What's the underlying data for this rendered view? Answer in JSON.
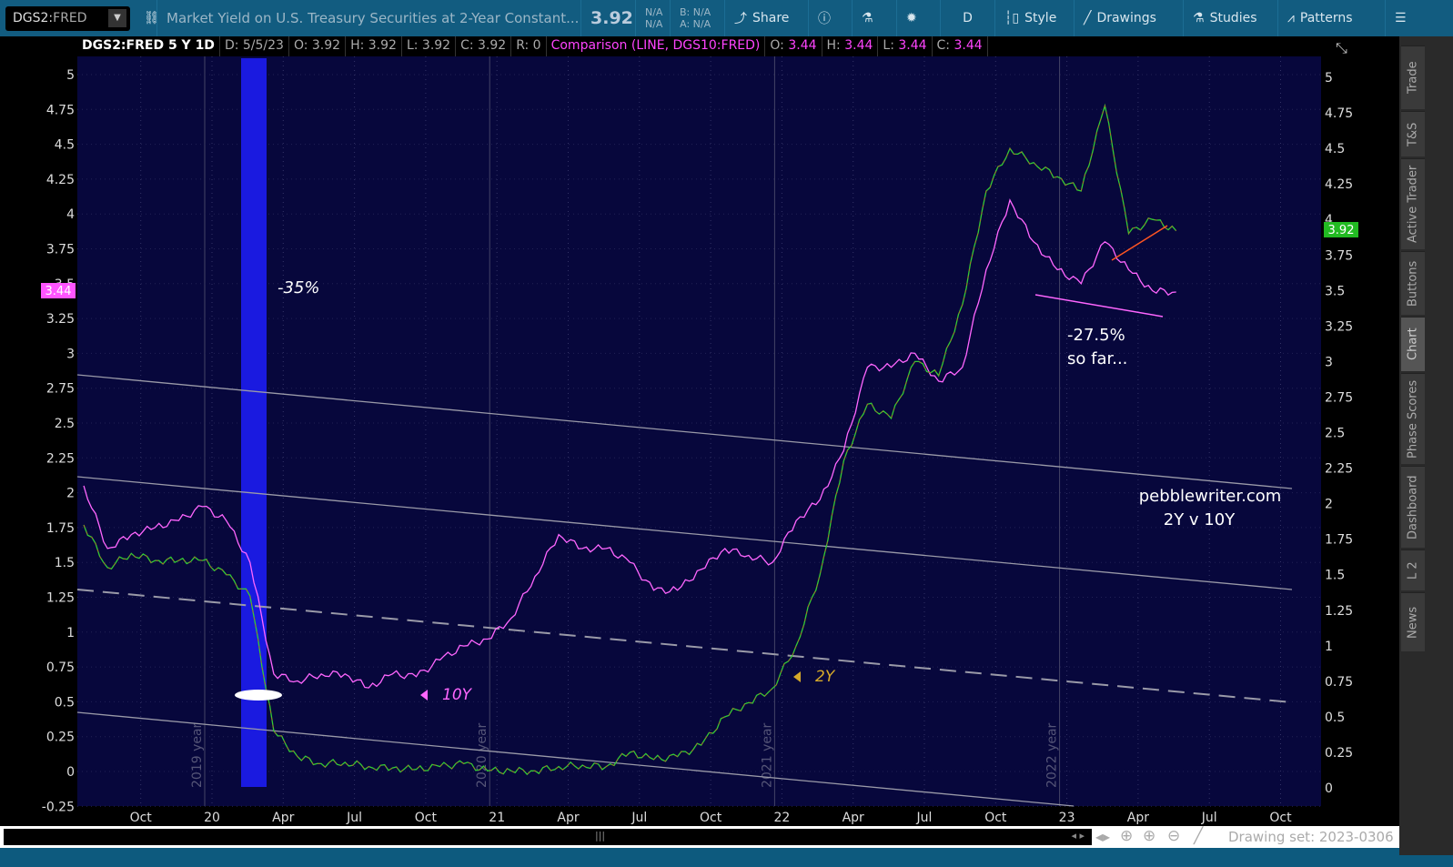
{
  "toolbar": {
    "symbol_prefix": "DGS2:",
    "symbol_suffix": "FRED",
    "description": "Market Yield on U.S. Treasury Securities at 2-Year Constant...",
    "last": "3.92",
    "na1": "N/A",
    "na2": "N/A",
    "bid": "B: N/A",
    "ask": "A: N/A",
    "share": "Share",
    "period": "D",
    "style": "Style",
    "drawings": "Drawings",
    "studies": "Studies",
    "patterns": "Patterns"
  },
  "info": {
    "title": "DGS2:FRED 5 Y 1D",
    "date": "D: 5/5/23",
    "o": "O: 3.92",
    "h": "H: 3.92",
    "l": "L: 3.92",
    "c": "C: 3.92",
    "r": "R: 0",
    "comparison": "Comparison (LINE, DGS10:FRED)",
    "co_l": "O: ",
    "co": "3.44",
    "ch_l": "H: ",
    "ch": "3.44",
    "cl_l": "L: ",
    "cl": "3.44",
    "cc_l": "C: ",
    "cc": "3.44"
  },
  "sidebar": [
    "Trade",
    "T&S",
    "Active Trader",
    "Buttons",
    "Chart",
    "Phase Scores",
    "Dashboard",
    "L 2",
    "News"
  ],
  "bottom": {
    "drawing_set": "Drawing set: 2023-0306"
  },
  "annotations": {
    "drop1": "-35%",
    "drop2a": "-27.5%",
    "drop2b": "so far...",
    "site": "pebblewriter.com",
    "sub": "2Y v 10Y",
    "label10": "10Y",
    "label2": "2Y"
  },
  "chart_data": {
    "type": "line",
    "title": "DGS2:FRED 5 Y 1D vs DGS10:FRED",
    "start": "2019-07",
    "interval": "monthly",
    "series": [
      {
        "name": "DGS10 (10Y)",
        "color": "#ff66ff",
        "axis": "left",
        "values": [
          2.05,
          1.6,
          1.7,
          1.75,
          1.8,
          1.9,
          1.8,
          1.5,
          0.7,
          0.65,
          0.7,
          0.7,
          0.6,
          0.7,
          0.68,
          0.8,
          0.9,
          0.95,
          1.1,
          1.4,
          1.7,
          1.6,
          1.6,
          1.5,
          1.3,
          1.3,
          1.45,
          1.6,
          1.55,
          1.5,
          1.8,
          1.95,
          2.3,
          2.9,
          2.9,
          3.0,
          2.8,
          2.9,
          3.6,
          4.1,
          3.8,
          3.6,
          3.5,
          3.8,
          3.6,
          3.45,
          3.44
        ]
      },
      {
        "name": "DGS2 (2Y)",
        "color": "#33cc33",
        "axis": "right",
        "values": [
          1.85,
          1.55,
          1.65,
          1.6,
          1.6,
          1.6,
          1.5,
          1.35,
          0.4,
          0.22,
          0.17,
          0.18,
          0.15,
          0.14,
          0.13,
          0.15,
          0.17,
          0.12,
          0.12,
          0.12,
          0.15,
          0.16,
          0.15,
          0.25,
          0.2,
          0.22,
          0.3,
          0.5,
          0.6,
          0.7,
          1.0,
          1.5,
          2.3,
          2.7,
          2.6,
          3.0,
          2.9,
          3.4,
          4.2,
          4.5,
          4.4,
          4.3,
          4.2,
          4.8,
          3.9,
          4.0,
          3.92
        ]
      }
    ],
    "left_ticks": [
      "5",
      "4.75",
      "4.5",
      "4.25",
      "4",
      "3.75",
      "3.5",
      "3.25",
      "3",
      "2.75",
      "2.5",
      "2.25",
      "2",
      "1.75",
      "1.5",
      "1.25",
      "1",
      "0.75",
      "0.5",
      "0.25",
      "0",
      "-0.25"
    ],
    "right_ticks": [
      "5",
      "4.75",
      "4.5",
      "4.25",
      "4",
      "3.75",
      "3.5",
      "3.25",
      "3",
      "2.75",
      "2.5",
      "2.25",
      "2",
      "1.75",
      "1.5",
      "1.25",
      "1",
      "0.75",
      "0.5",
      "0.25",
      "0"
    ],
    "x_ticks": [
      "Oct",
      "20",
      "Apr",
      "Jul",
      "Oct",
      "21",
      "Apr",
      "Jul",
      "Oct",
      "22",
      "Apr",
      "Jul",
      "Oct",
      "23",
      "Apr",
      "Jul",
      "Oct"
    ],
    "year_labels": [
      "2019 year",
      "2020 year",
      "2021 year",
      "2022 year"
    ],
    "last_left": "3.44",
    "last_right": "3.92"
  }
}
